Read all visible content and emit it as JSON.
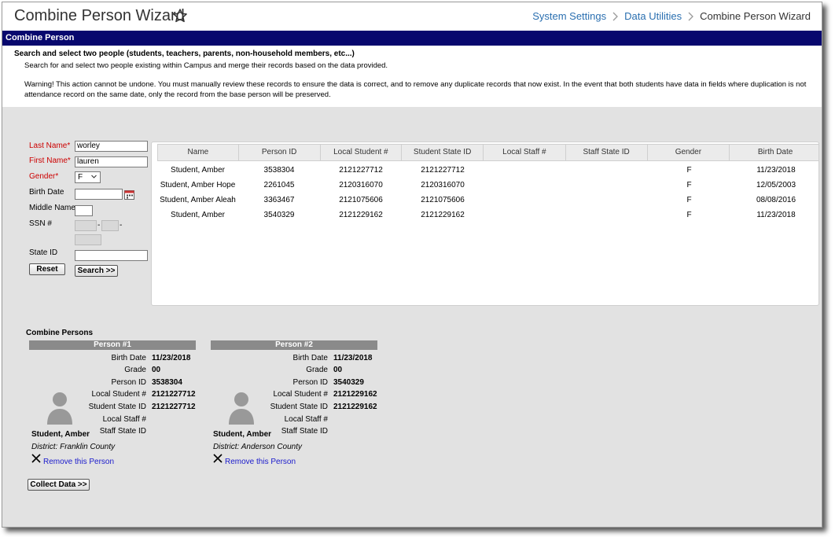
{
  "header": {
    "title": "Combine Person Wizard",
    "breadcrumb": [
      "System Settings",
      "Data Utilities",
      "Combine Person Wizard"
    ]
  },
  "section_bar": "Combine Person",
  "intro": {
    "heading": "Search and select two people (students, teachers, parents, non-household members, etc...)",
    "paragraph": "Search for and select two people existing within Campus and merge their records based on the data provided.",
    "warning_line1": "Warning! This action cannot be undone. You must manually review these records to ensure the data is correct, and to remove any duplicate records that now exist. In the event that both students have data in fields where duplication is not",
    "warning_line2": "attendance record on the same date, only the record from the base person will be preserved."
  },
  "search_form": {
    "last_name_label": "Last Name*",
    "last_name_value": "worley",
    "first_name_label": "First Name*",
    "first_name_value": "lauren",
    "gender_label": "Gender*",
    "gender_value": "F",
    "birth_date_label": "Birth Date",
    "middle_name_label": "Middle Name",
    "ssn_label": "SSN #",
    "ssn_dash": "-",
    "state_id_label": "State ID",
    "reset_button": "Reset",
    "search_button": "Search >>"
  },
  "results": {
    "columns": [
      "Name",
      "Person ID",
      "Local Student #",
      "Student State ID",
      "Local Staff #",
      "Staff State ID",
      "Gender",
      "Birth Date"
    ],
    "rows": [
      [
        "Student, Amber",
        "3538304",
        "2121227712",
        "2121227712",
        "",
        "",
        "F",
        "11/23/2018"
      ],
      [
        "Student, Amber Hope",
        "2261045",
        "2120316070",
        "2120316070",
        "",
        "",
        "F",
        "12/05/2003"
      ],
      [
        "Student, Amber Aleah",
        "3363467",
        "2121075606",
        "2121075606",
        "",
        "",
        "F",
        "08/08/2016"
      ],
      [
        "Student, Amber",
        "3540329",
        "2121229162",
        "2121229162",
        "",
        "",
        "F",
        "11/23/2018"
      ]
    ]
  },
  "combine": {
    "title": "Combine Persons",
    "field_labels": [
      "Birth Date",
      "Grade",
      "Person ID",
      "Local Student #",
      "Student State ID",
      "Local Staff #",
      "Staff State ID"
    ],
    "remove_label": "Remove this Person",
    "collect_button": "Collect Data >>",
    "persons": [
      {
        "header": "Person #1",
        "values": [
          "11/23/2018",
          "00",
          "3538304",
          "2121227712",
          "2121227712",
          "",
          ""
        ],
        "name": "Student, Amber",
        "district": "District: Franklin County"
      },
      {
        "header": "Person #2",
        "values": [
          "11/23/2018",
          "00",
          "3540329",
          "2121229162",
          "2121229162",
          "",
          ""
        ],
        "name": "Student, Amber",
        "district": "District: Anderson County"
      }
    ]
  }
}
